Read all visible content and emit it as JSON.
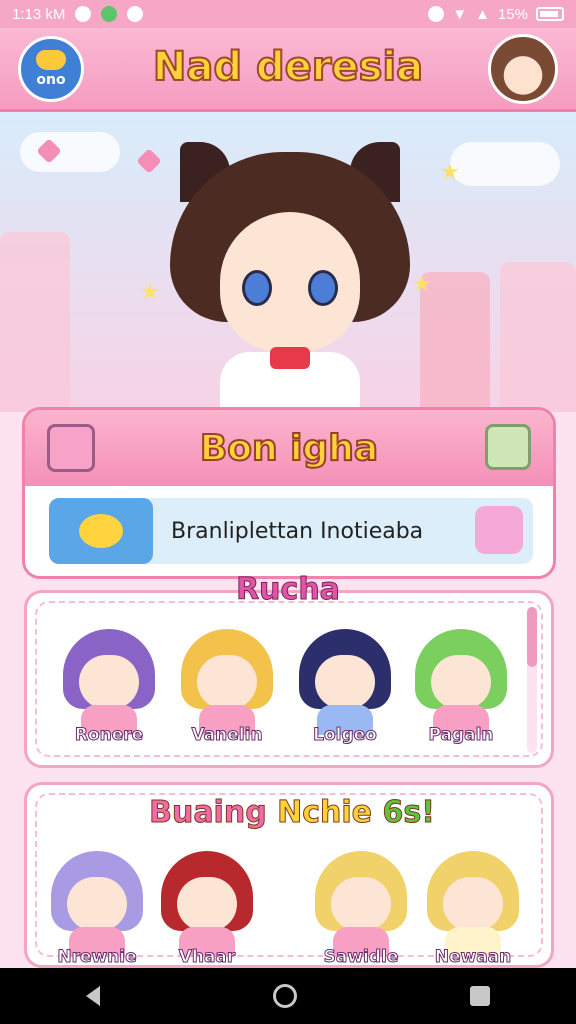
{
  "status_bar": {
    "time": "1:13 kM",
    "battery": "15%"
  },
  "header": {
    "logo_text": "ono",
    "title": "Nad deresia"
  },
  "feature": {
    "title": "Bon igha",
    "banner_text": "Branliplettan Inotieaba"
  },
  "section1": {
    "title": "Rucha",
    "characters": [
      {
        "name": "Ronere",
        "hair": "#8a63c6"
      },
      {
        "name": "Vanelin",
        "hair": "#f2c24a"
      },
      {
        "name": "Lolgeo",
        "hair": "#2c2f6b"
      },
      {
        "name": "Pagaln",
        "hair": "#7bcf5f"
      }
    ]
  },
  "section2": {
    "title_part1": "Buaing",
    "title_part2": "Nchie",
    "title_part3": "6s!",
    "characters": [
      {
        "name": "Nrewnie",
        "hair": "#a89be3"
      },
      {
        "name": "Vhaar",
        "hair": "#b8292d"
      },
      {
        "name": "Sawidle",
        "hair": "#f0d16a"
      },
      {
        "name": "Newaan",
        "hair": "#f0d16a"
      }
    ]
  },
  "nav": {
    "back": "back",
    "home": "home",
    "recent": "recent"
  }
}
